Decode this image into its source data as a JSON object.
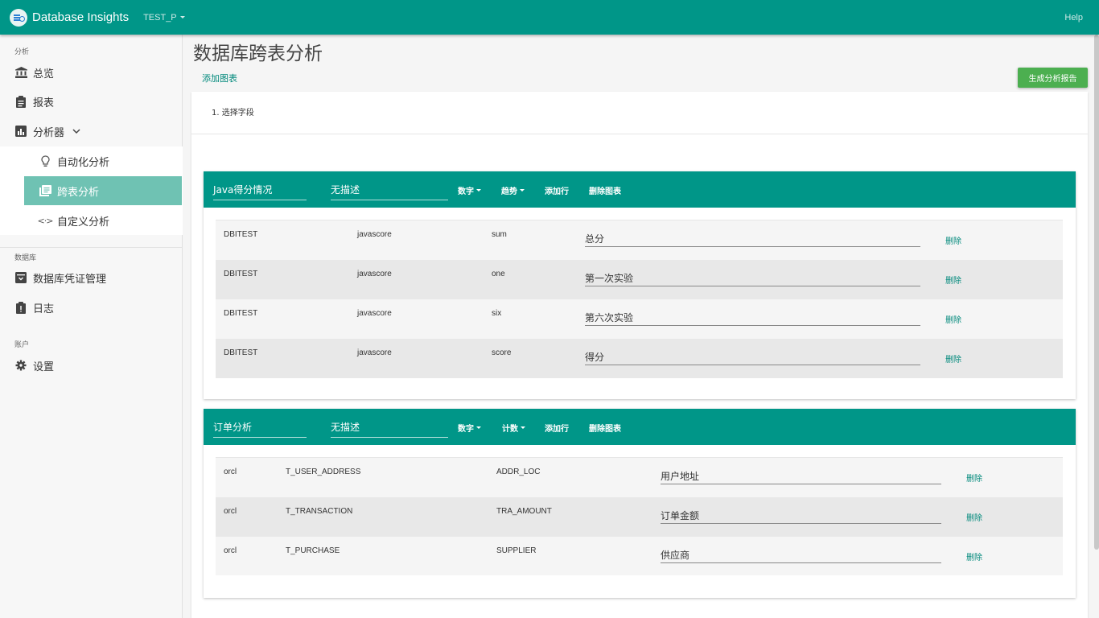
{
  "app": {
    "title": "Database Insights",
    "env": "TEST_P",
    "help": "Help"
  },
  "sidebar": {
    "section_analysis": "分析",
    "overview": "总览",
    "reports": "报表",
    "analyzer": "分析器",
    "sub_items": [
      "自动化分析",
      "跨表分析",
      "自定义分析"
    ],
    "section_database": "数据库",
    "credentials": "数据库凭证管理",
    "logs": "日志",
    "section_account": "账户",
    "settings": "设置"
  },
  "main": {
    "title": "数据库跨表分析",
    "add_chart": "添加图表",
    "generate_report": "生成分析报告",
    "step_label": "1. 选择字段"
  },
  "charts": [
    {
      "name": "Java得分情况",
      "description": "无描述",
      "menu_type": "数字",
      "menu_mode": "趋势",
      "add_row": "添加行",
      "delete_chart": "删除图表",
      "rows": [
        {
          "db": "DBITEST",
          "table": "javascore",
          "field": "sum",
          "alias": "总分",
          "delete": "删除"
        },
        {
          "db": "DBITEST",
          "table": "javascore",
          "field": "one",
          "alias": "第一次实验",
          "delete": "删除"
        },
        {
          "db": "DBITEST",
          "table": "javascore",
          "field": "six",
          "alias": "第六次实验",
          "delete": "删除"
        },
        {
          "db": "DBITEST",
          "table": "javascore",
          "field": "score",
          "alias": "得分",
          "delete": "删除"
        }
      ]
    },
    {
      "name": "订单分析",
      "description": "无描述",
      "menu_type": "数字",
      "menu_mode": "计数",
      "add_row": "添加行",
      "delete_chart": "删除图表",
      "rows": [
        {
          "db": "orcl",
          "table": "T_USER_ADDRESS",
          "field": "ADDR_LOC",
          "alias": "用户地址",
          "delete": "删除"
        },
        {
          "db": "orcl",
          "table": "T_TRANSACTION",
          "field": "TRA_AMOUNT",
          "alias": "订单金额",
          "delete": "删除"
        },
        {
          "db": "orcl",
          "table": "T_PURCHASE",
          "field": "SUPPLIER",
          "alias": "供应商",
          "delete": "删除"
        }
      ]
    }
  ],
  "colors": {
    "primary": "#009688",
    "active_nav": "#6fc2b3",
    "report_button": "#4caf50"
  }
}
